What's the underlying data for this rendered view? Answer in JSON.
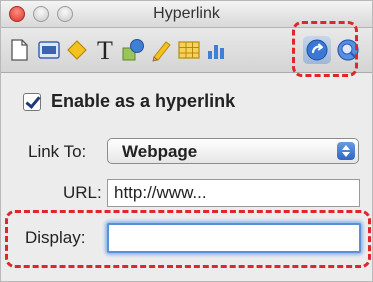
{
  "window": {
    "title": "Hyperlink"
  },
  "toolbar": {
    "items": [
      {
        "icon": "document-icon"
      },
      {
        "icon": "layout-icon"
      },
      {
        "icon": "fill-icon"
      },
      {
        "icon": "text-icon"
      },
      {
        "icon": "shape-icon"
      },
      {
        "icon": "pencil-icon"
      },
      {
        "icon": "table-icon"
      },
      {
        "icon": "chart-icon"
      },
      {
        "icon": "hyperlink-icon"
      },
      {
        "icon": "quicktime-icon"
      }
    ],
    "active_index": 8
  },
  "form": {
    "enable_label": "Enable as a hyperlink",
    "enable_checked": true,
    "link_to_label": "Link To:",
    "link_to_value": "Webpage",
    "url_label": "URL:",
    "url_value": "http://www...",
    "display_label": "Display:",
    "display_value": ""
  },
  "colors": {
    "highlight": "#e0262b",
    "focus_ring": "#5b8fd6"
  }
}
